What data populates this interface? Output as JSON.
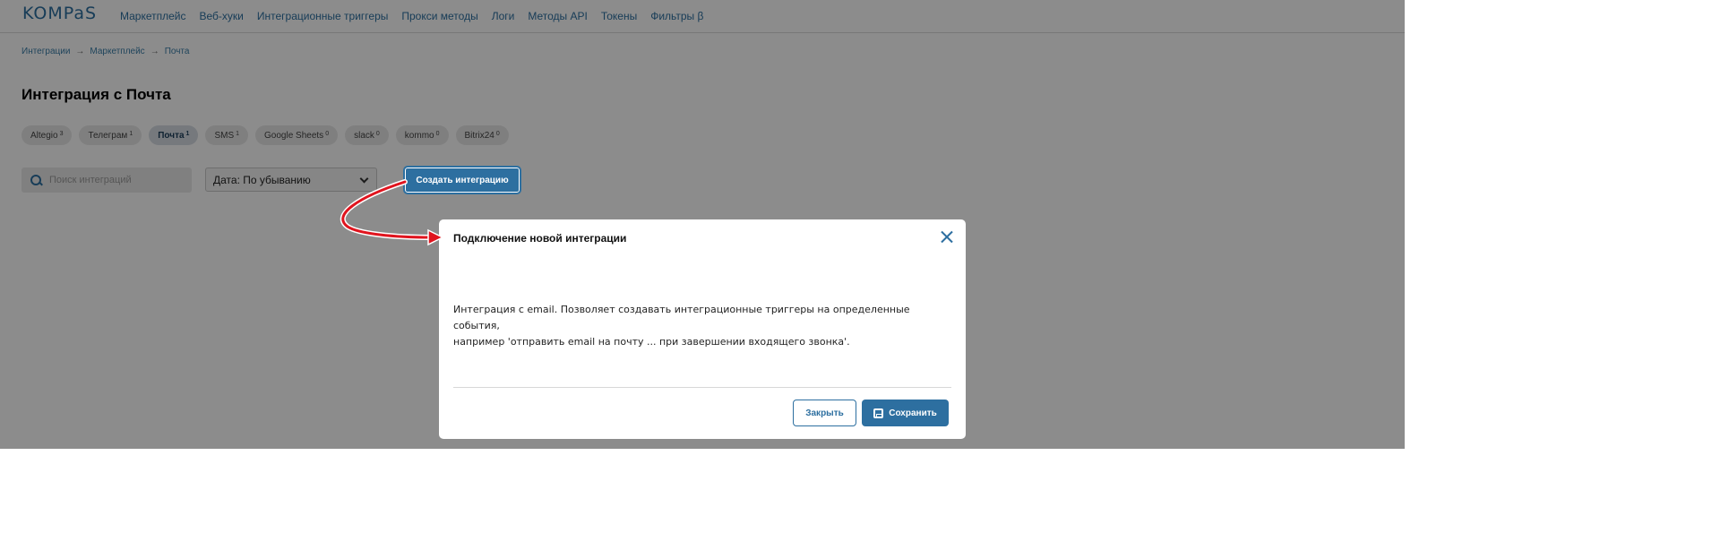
{
  "app": {
    "logo_text": "KOMPaS"
  },
  "nav": {
    "items": [
      {
        "label": "Маркетплейс"
      },
      {
        "label": "Веб-хуки"
      },
      {
        "label": "Интеграционные триггеры"
      },
      {
        "label": "Прокси методы"
      },
      {
        "label": "Логи"
      },
      {
        "label": "Методы API"
      },
      {
        "label": "Токены"
      },
      {
        "label": "Фильтры β"
      }
    ]
  },
  "breadcrumb": {
    "items": [
      "Интеграции",
      "Маркетплейс",
      "Почта"
    ],
    "separator": "→"
  },
  "page": {
    "title": "Интеграция с Почта"
  },
  "tabs": [
    {
      "label": "Altegio",
      "count": "3",
      "active": false
    },
    {
      "label": "Телеграм",
      "count": "1",
      "active": false
    },
    {
      "label": "Почта",
      "count": "1",
      "active": true
    },
    {
      "label": "SMS",
      "count": "1",
      "active": false
    },
    {
      "label": "Google Sheets",
      "count": "0",
      "active": false
    },
    {
      "label": "slack",
      "count": "0",
      "active": false
    },
    {
      "label": "kommo",
      "count": "0",
      "active": false
    },
    {
      "label": "Bitrix24",
      "count": "0",
      "active": false
    }
  ],
  "toolbar": {
    "search_placeholder": "Поиск интеграций",
    "sort_value": "Дата: По убыванию",
    "create_label": "Создать интеграцию"
  },
  "modal": {
    "title": "Подключение новой интеграции",
    "body_line1": "Интеграция с email. Позволяет создавать интеграционные триггеры на определенные события,",
    "body_line2": "например 'отправить email на почту ... при завершении входящего звонка'.",
    "close_label": "Закрыть",
    "save_label": "Сохранить"
  },
  "colors": {
    "accent": "#2d6fa0",
    "annotation_arrow": "#e0141e"
  }
}
